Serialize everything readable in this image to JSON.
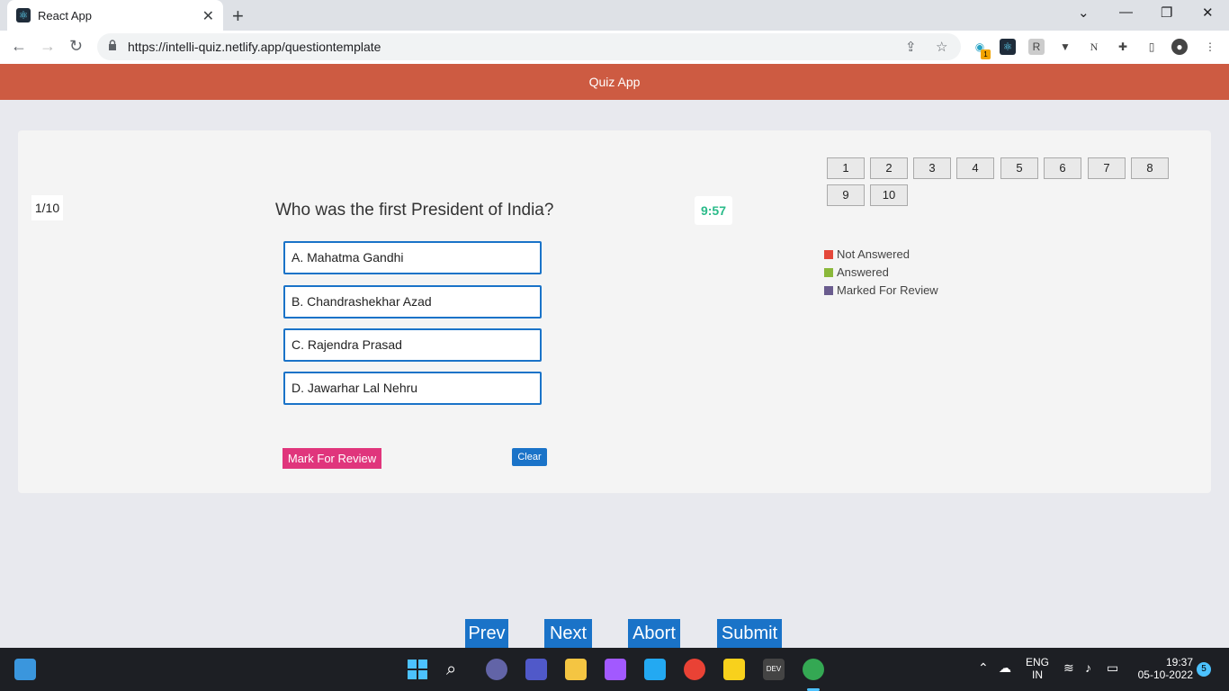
{
  "browser": {
    "tab_title": "React App",
    "url": "https://intelli-quiz.netlify.app/questiontemplate",
    "extension_badge": "1"
  },
  "app": {
    "title": "Quiz App"
  },
  "quiz": {
    "counter": "1/10",
    "question": "Who was the first President of India?",
    "timer": "9:57",
    "options": [
      "A. Mahatma Gandhi",
      "B. Chandrashekhar Azad",
      "C. Rajendra Prasad",
      "D. Jawarhar Lal Nehru"
    ],
    "mark_review_label": "Mark For Review",
    "clear_label": "Clear"
  },
  "palette": {
    "numbers": [
      "1",
      "2",
      "3",
      "4",
      "5",
      "6",
      "7",
      "8",
      "9",
      "10"
    ],
    "legend": [
      {
        "label": "Not Answered",
        "color": "#e4473a"
      },
      {
        "label": "Answered",
        "color": "#8ab83a"
      },
      {
        "label": "Marked For Review",
        "color": "#6a5c8e"
      }
    ]
  },
  "nav": {
    "prev": "Prev",
    "next": "Next",
    "abort": "Abort",
    "submit": "Submit"
  },
  "taskbar": {
    "lang_line1": "ENG",
    "lang_line2": "IN",
    "time": "19:37",
    "date": "05-10-2022",
    "notifications": "5"
  },
  "colors": {
    "header": "#cd5b42",
    "accent": "#1a73c8",
    "timer": "#2bbb8a",
    "mark": "#e0357c"
  }
}
